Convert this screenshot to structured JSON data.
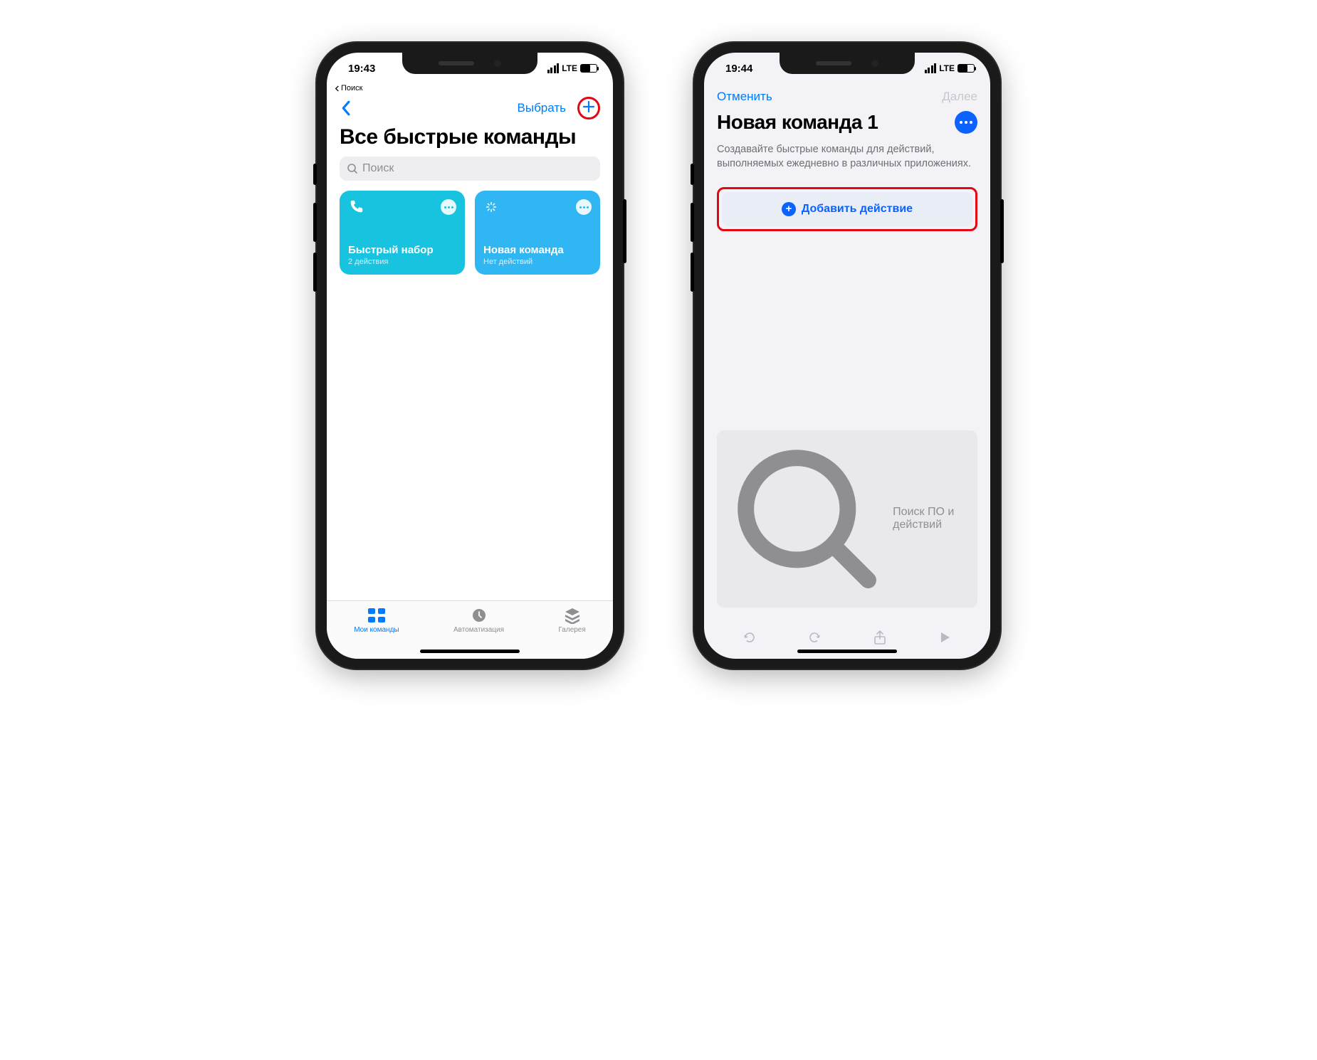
{
  "left": {
    "status": {
      "time": "19:43",
      "net": "LTE"
    },
    "breadcrumb": "Поиск",
    "nav": {
      "select": "Выбрать"
    },
    "title": "Все быстрые команды",
    "search_placeholder": "Поиск",
    "cards": [
      {
        "title": "Быстрый набор",
        "sub": "2 действия"
      },
      {
        "title": "Новая команда",
        "sub": "Нет действий"
      }
    ],
    "tabs": {
      "my": "Мои команды",
      "automation": "Автоматизация",
      "gallery": "Галерея"
    }
  },
  "right": {
    "status": {
      "time": "19:44",
      "net": "LTE"
    },
    "nav": {
      "cancel": "Отменить",
      "next": "Далее"
    },
    "title": "Новая команда 1",
    "description": "Создавайте быстрые команды для действий, выполняемых ежедневно в различных приложениях.",
    "add_action": "Добавить действие",
    "search_placeholder": "Поиск ПО и действий"
  }
}
